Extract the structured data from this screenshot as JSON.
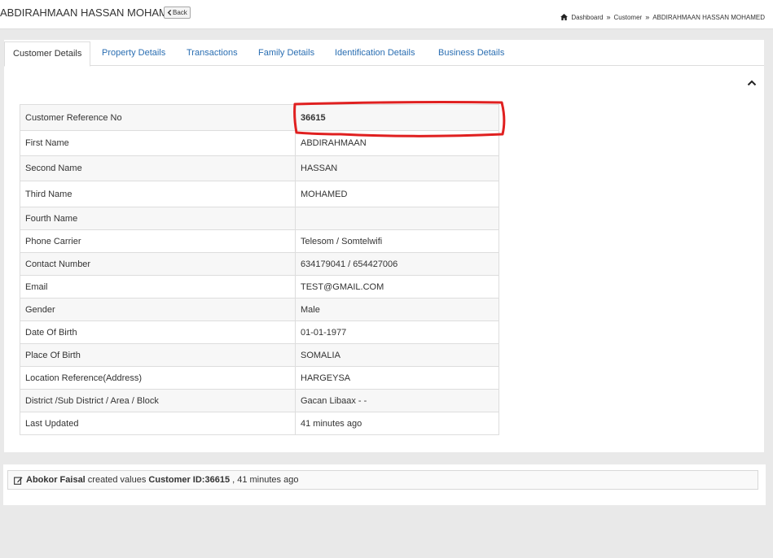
{
  "header": {
    "title": "ABDIRAHMAAN HASSAN MOHAMED",
    "back_label": "Back"
  },
  "breadcrumb": {
    "items": [
      "Dashboard",
      "Customer",
      "ABDIRAHMAAN HASSAN MOHAMED"
    ],
    "separator": "»"
  },
  "tabs": [
    {
      "label": "Customer Details",
      "active": true
    },
    {
      "label": "Property Details",
      "active": false
    },
    {
      "label": "Transactions",
      "active": false
    },
    {
      "label": "Family Details",
      "active": false
    },
    {
      "label": "Identification Details",
      "active": false
    },
    {
      "label": "Business Details",
      "active": false
    }
  ],
  "details": {
    "rows": [
      {
        "label": "Customer Reference No",
        "value": "36615"
      },
      {
        "label": "First Name",
        "value": "ABDIRAHMAAN"
      },
      {
        "label": "Second Name",
        "value": "HASSAN"
      },
      {
        "label": "Third Name",
        "value": "MOHAMED"
      },
      {
        "label": "Fourth Name",
        "value": ""
      },
      {
        "label": "Phone Carrier",
        "value": "Telesom / Somtelwifi"
      },
      {
        "label": "Contact Number",
        "value": "634179041 / 654427006"
      },
      {
        "label": "Email",
        "value": "TEST@GMAIL.COM"
      },
      {
        "label": "Gender",
        "value": "Male"
      },
      {
        "label": "Date Of Birth",
        "value": "01-01-1977"
      },
      {
        "label": "Place Of Birth",
        "value": "SOMALIA"
      },
      {
        "label": "Location Reference(Address)",
        "value": "HARGEYSA"
      },
      {
        "label": "District /Sub District / Area / Block",
        "value": "Gacan Libaax - -"
      },
      {
        "label": "Last Updated",
        "value": "41 minutes ago"
      }
    ]
  },
  "activity": {
    "user": "Abokor Faisal",
    "action": " created values ",
    "target": "Customer ID:36615",
    "time": " , 41 minutes ago"
  },
  "colors": {
    "link": "#2a6eb2",
    "highlight": "#e02020"
  },
  "icons": {
    "back": "chevron-left-icon",
    "home": "home-icon",
    "collapse": "chevron-up-icon",
    "activity": "edit-icon"
  }
}
